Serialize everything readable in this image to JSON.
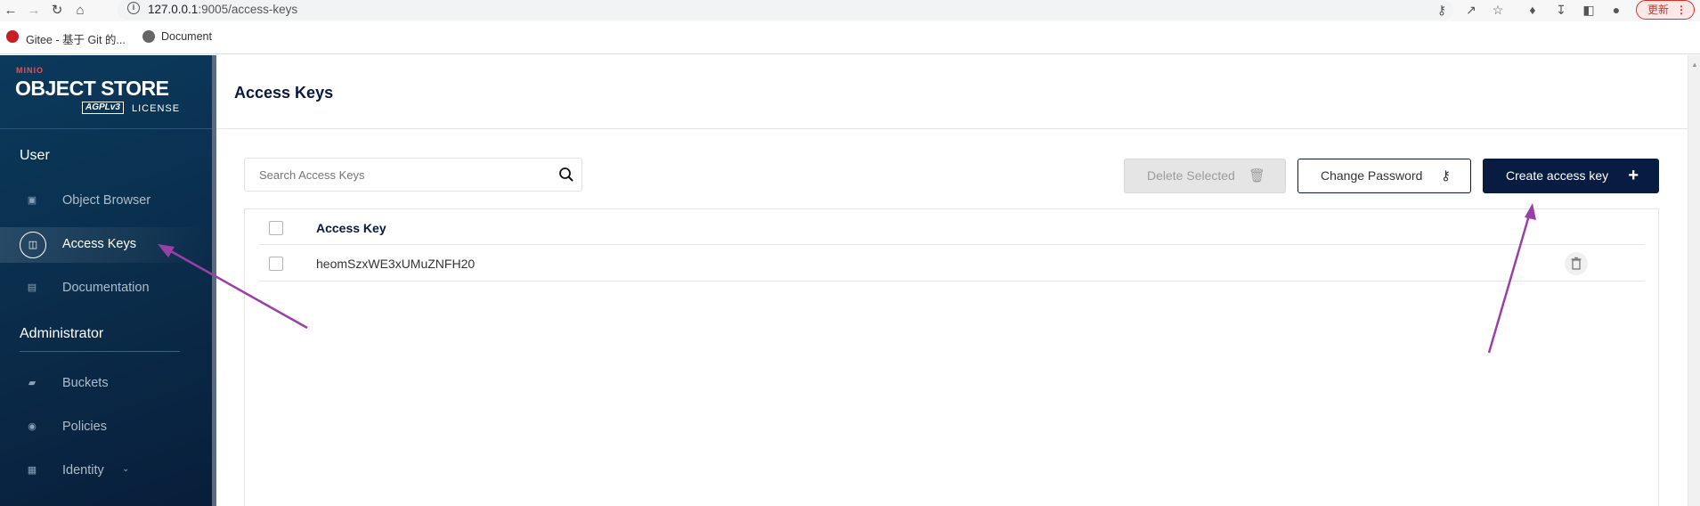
{
  "browser": {
    "url_host": "127.0.0.1",
    "url_rest": ":9005/access-keys",
    "update_label": "更新",
    "bookmarks": [
      {
        "label": "Gitee - 基于 Git 的..."
      },
      {
        "label": "Document"
      }
    ]
  },
  "sidebar": {
    "logo_brand": "MINIO",
    "logo_product": "OBJECT STORE",
    "logo_agpl": "AGPLv3",
    "logo_license": "LICENSE",
    "sections": [
      {
        "title": "User",
        "items": [
          {
            "label": "Object Browser",
            "icon": "object-browser-icon",
            "active": false
          },
          {
            "label": "Access Keys",
            "icon": "access-keys-icon",
            "active": true
          },
          {
            "label": "Documentation",
            "icon": "documentation-icon",
            "active": false
          }
        ]
      },
      {
        "title": "Administrator",
        "items": [
          {
            "label": "Buckets",
            "icon": "buckets-icon",
            "active": false
          },
          {
            "label": "Policies",
            "icon": "policies-icon",
            "active": false
          },
          {
            "label": "Identity",
            "icon": "identity-icon",
            "active": false,
            "expandable": true
          }
        ]
      }
    ]
  },
  "main": {
    "title": "Access Keys",
    "search_placeholder": "Search Access Keys",
    "buttons": {
      "delete_selected": "Delete Selected",
      "change_password": "Change Password",
      "create_access_key": "Create access key"
    },
    "table": {
      "header": "Access Key",
      "rows": [
        {
          "access_key": "heomSzxWE3xUMuZNFH20"
        }
      ]
    }
  },
  "colors": {
    "sidebar_dark": "#0a2d4b",
    "primary_navy": "#081c42",
    "annotation_arrow": "#9b3fa8",
    "update_red": "#d93025"
  }
}
